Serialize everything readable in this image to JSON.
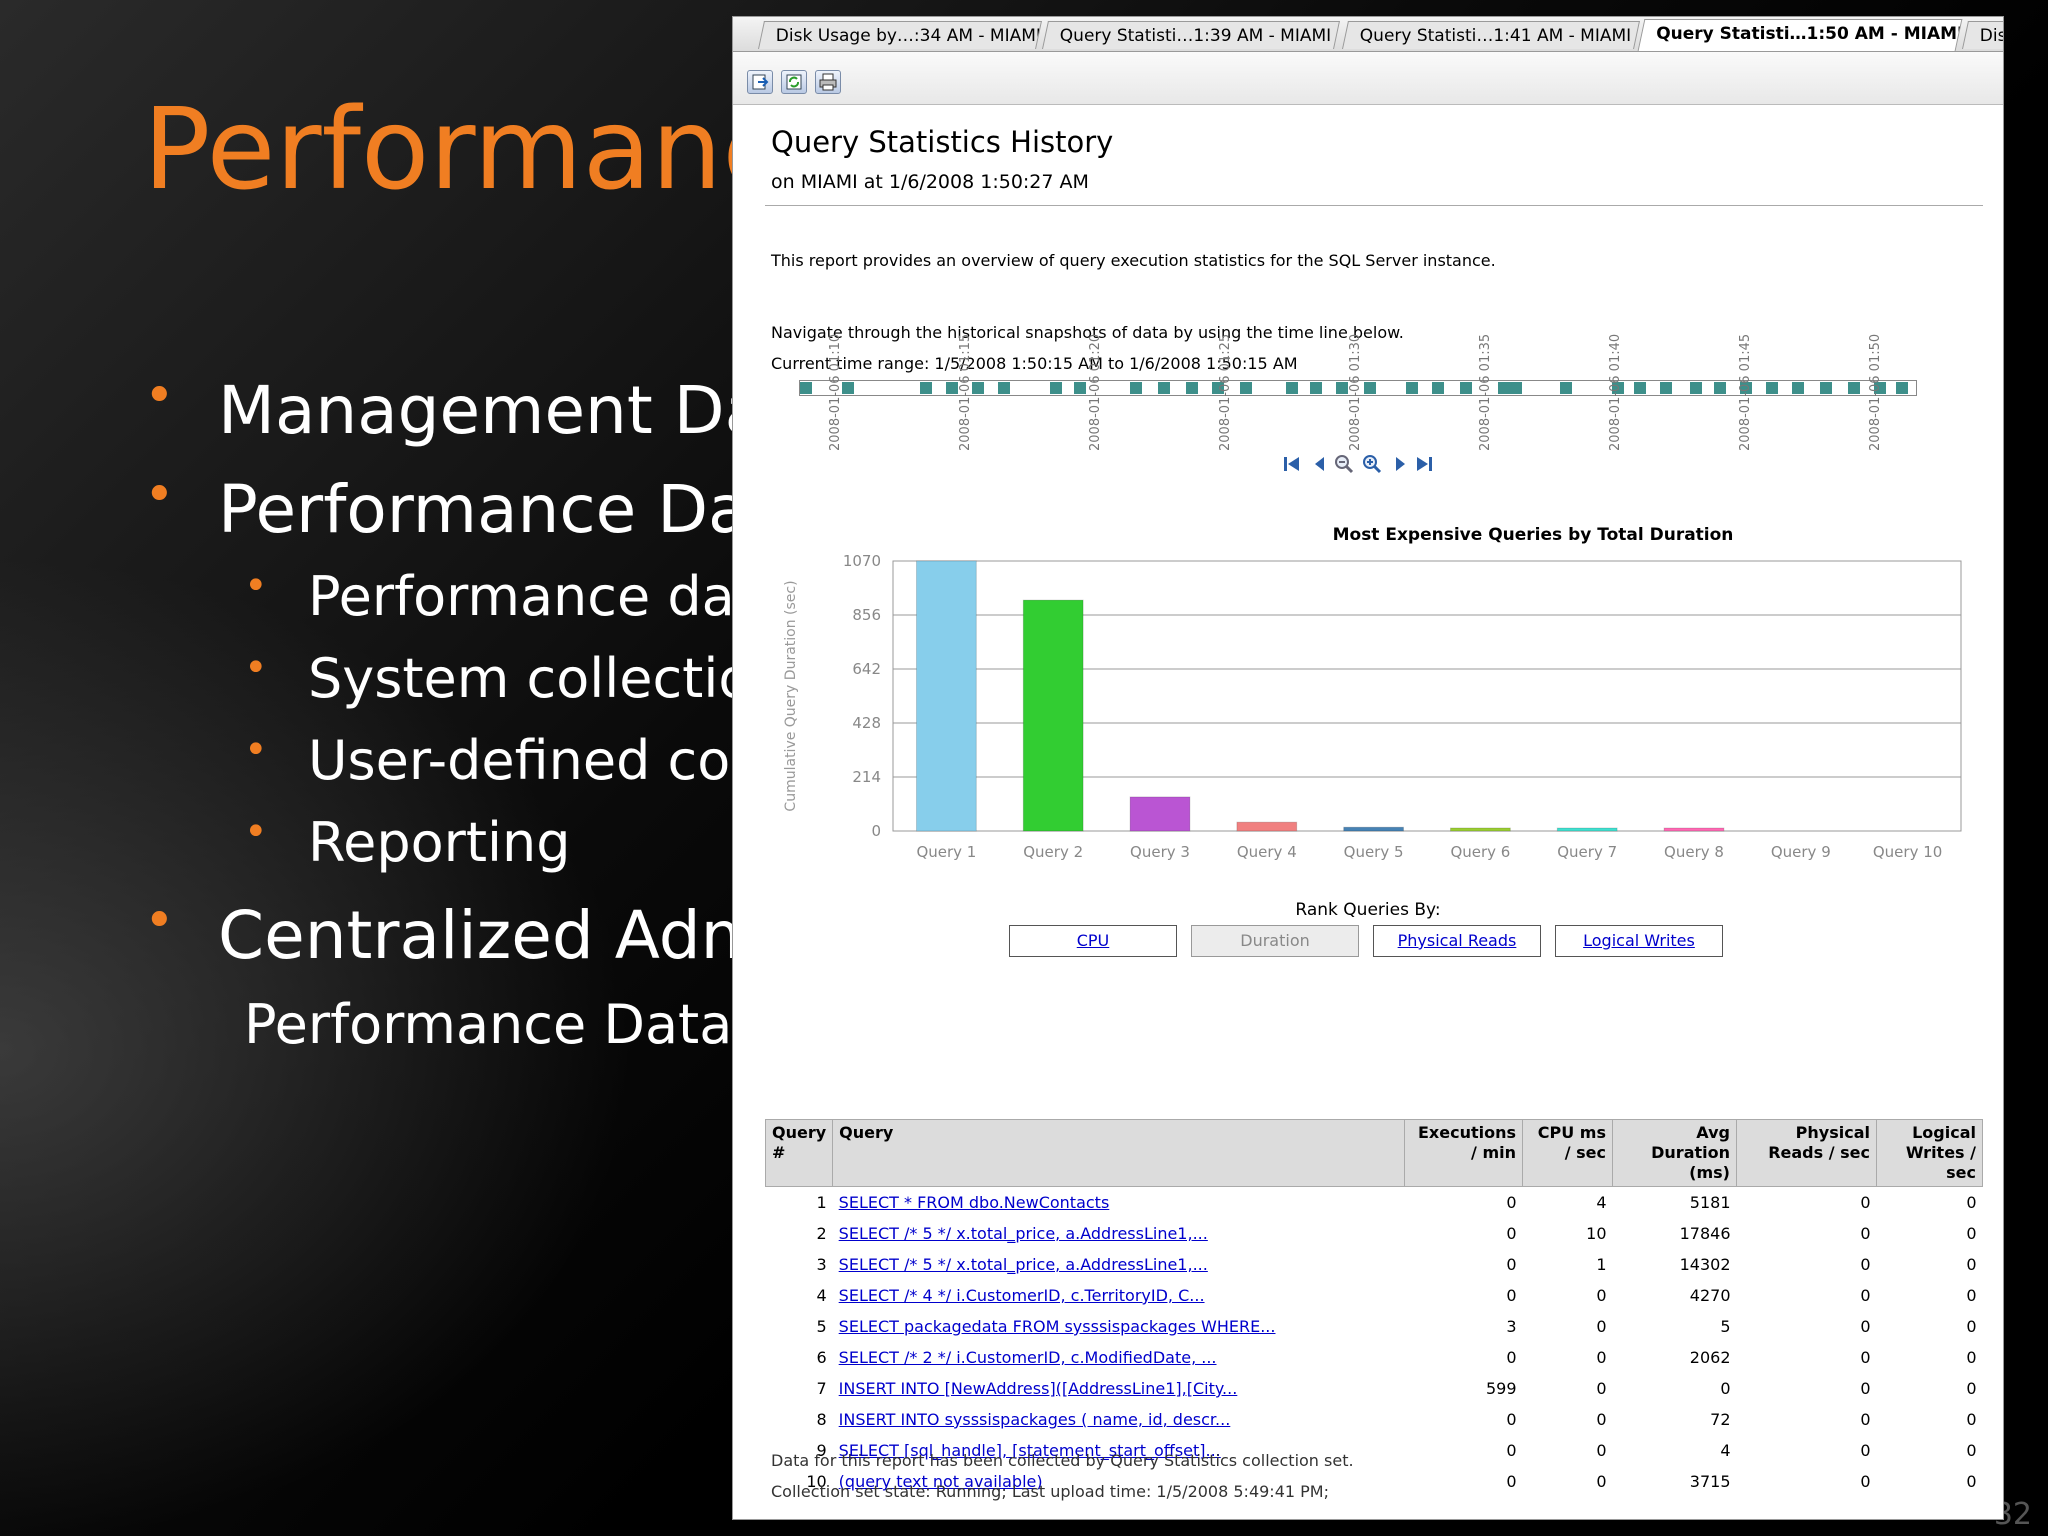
{
  "slide": {
    "title": "Performance",
    "bullets": [
      {
        "text": "Management Dat",
        "level": 1
      },
      {
        "text": "Performance Data",
        "level": 1
      },
      {
        "text": "Performance data",
        "level": 2
      },
      {
        "text": "System collection",
        "level": 2
      },
      {
        "text": "User-defined coll",
        "level": 2
      },
      {
        "text": "Reporting",
        "level": 2
      },
      {
        "text": "Centralized Admi",
        "level": 1
      },
      {
        "text": "Performance Data C",
        "level": 3
      }
    ],
    "page_number": "32"
  },
  "tabs": [
    {
      "label": "Disk Usage by…:34 AM - MIAMI",
      "active": false
    },
    {
      "label": "Query Statisti…1:39 AM - MIAMI",
      "active": false
    },
    {
      "label": "Query Statisti…1:41 AM - MIAMI",
      "active": false
    },
    {
      "label": "Query Statisti…1:50 AM - MIAMI",
      "active": true
    },
    {
      "label": "Disk",
      "active": false
    }
  ],
  "toolbar": {
    "icons": [
      "export-icon",
      "refresh-icon",
      "print-icon"
    ]
  },
  "report": {
    "title": "Query Statistics History",
    "subtitle": "on MIAMI at 1/6/2008 1:50:27 AM",
    "description": "This report provides an overview of query execution statistics for the SQL Server instance.",
    "navigate_text": "Navigate through the historical snapshots of data by using the time line below.",
    "time_range": "Current time range: 1/5/2008 1:50:15 AM to 1/6/2008 1:50:15 AM",
    "timeline_labels": [
      "2008-01-06 01:10",
      "2008-01-06 01:15",
      "2008-01-06 01:20",
      "2008-01-06 01:25",
      "2008-01-06 01:30",
      "2008-01-06 01:35",
      "2008-01-06 01:40",
      "2008-01-06 01:45",
      "2008-01-06 01:50"
    ],
    "rank_label": "Rank Queries By:",
    "rank_buttons": [
      {
        "label": "CPU",
        "state": "link"
      },
      {
        "label": "Duration",
        "state": "disabled"
      },
      {
        "label": "Physical Reads",
        "state": "link"
      },
      {
        "label": "Logical Writes",
        "state": "link"
      }
    ],
    "footer_1": "Data for this report has been collected by Query Statistics collection set.",
    "footer_2": "Collection set state: Running; Last upload time: 1/5/2008 5:49:41 PM;"
  },
  "chart_data": {
    "type": "bar",
    "title": "Most Expensive Queries by Total Duration",
    "xlabel": "",
    "ylabel": "Cumulative Query Duration (sec)",
    "categories": [
      "Query 1",
      "Query 2",
      "Query 3",
      "Query 4",
      "Query 5",
      "Query 6",
      "Query 7",
      "Query 8",
      "Query 9",
      "Query 10"
    ],
    "values": [
      1070,
      915,
      135,
      35,
      15,
      12,
      4,
      3,
      0,
      0
    ],
    "colors": [
      "#87ceeb",
      "#32cd32",
      "#ba55d3",
      "#f08080",
      "#4682b4",
      "#9acd32",
      "#40e0d0",
      "#ff69b4",
      "#cccccc",
      "#cccccc"
    ],
    "yticks": [
      0,
      214,
      428,
      642,
      856,
      1070
    ],
    "ylim": [
      0,
      1070
    ],
    "grid": true
  },
  "table": {
    "headers": [
      "Query #",
      "Query",
      "Executions / min",
      "CPU ms / sec",
      "Avg Duration (ms)",
      "Physical Reads / sec",
      "Logical Writes / sec"
    ],
    "rows": [
      [
        "1",
        "SELECT * FROM dbo.NewContacts",
        "0",
        "4",
        "5181",
        "0",
        "0"
      ],
      [
        "2",
        "SELECT /* 5 */ x.total_price, a.AddressLine1,...",
        "0",
        "10",
        "17846",
        "0",
        "0"
      ],
      [
        "3",
        "SELECT /* 5 */ x.total_price, a.AddressLine1,...",
        "0",
        "1",
        "14302",
        "0",
        "0"
      ],
      [
        "4",
        "SELECT /* 4 */ i.CustomerID, c.TerritoryID, C...",
        "0",
        "0",
        "4270",
        "0",
        "0"
      ],
      [
        "5",
        "SELECT packagedata FROM sysssispackages WHERE...",
        "3",
        "0",
        "5",
        "0",
        "0"
      ],
      [
        "6",
        "SELECT /* 2 */ i.CustomerID, c.ModifiedDate, ...",
        "0",
        "0",
        "2062",
        "0",
        "0"
      ],
      [
        "7",
        "INSERT INTO [NewAddress]([AddressLine1],[City...",
        "599",
        "0",
        "0",
        "0",
        "0"
      ],
      [
        "8",
        "INSERT INTO sysssispackages ( name, id, descr...",
        "0",
        "0",
        "72",
        "0",
        "0"
      ],
      [
        "9",
        "SELECT [sql_handle], [statement_start_offset]...",
        "0",
        "0",
        "4",
        "0",
        "0"
      ],
      [
        "10",
        "(query text not available)",
        "0",
        "0",
        "3715",
        "0",
        "0"
      ]
    ]
  }
}
